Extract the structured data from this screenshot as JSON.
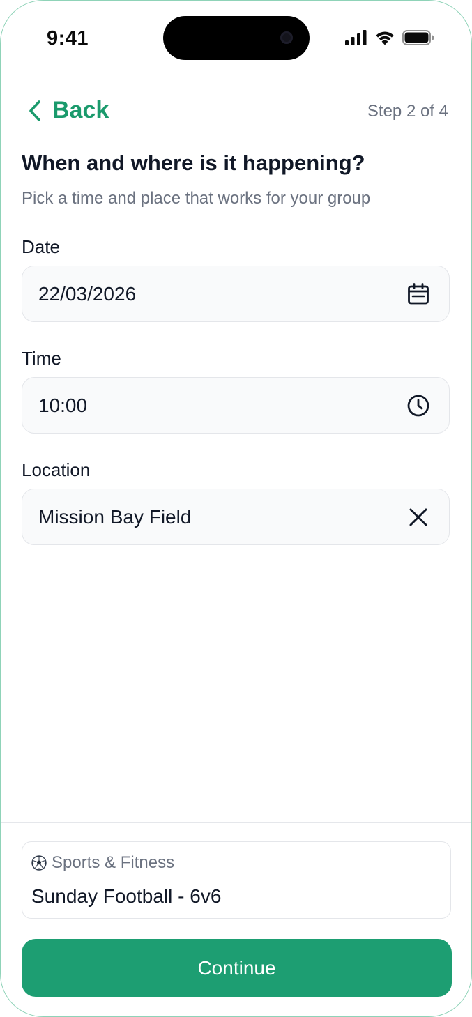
{
  "status_bar": {
    "time": "9:41"
  },
  "nav": {
    "back_label": "Back",
    "step": "Step 2 of 4"
  },
  "header": {
    "title": "When and where is it happening?",
    "subtitle": "Pick a time and place that works for your group"
  },
  "fields": {
    "date": {
      "label": "Date",
      "value": "22/03/2026",
      "icon": "calendar-icon"
    },
    "time": {
      "label": "Time",
      "value": "10:00",
      "icon": "clock-icon"
    },
    "location": {
      "label": "Location",
      "value": "Mission Bay Field",
      "icon": "clear-icon"
    }
  },
  "event_card": {
    "category_icon": "⚽",
    "category": "Sports & Fitness",
    "title": "Sunday Football - 6v6"
  },
  "footer": {
    "continue_label": "Continue"
  },
  "colors": {
    "accent": "#1d9e72",
    "muted_text": "#6b7280",
    "field_bg": "#f9fafb",
    "field_border": "#e4e6ea"
  }
}
